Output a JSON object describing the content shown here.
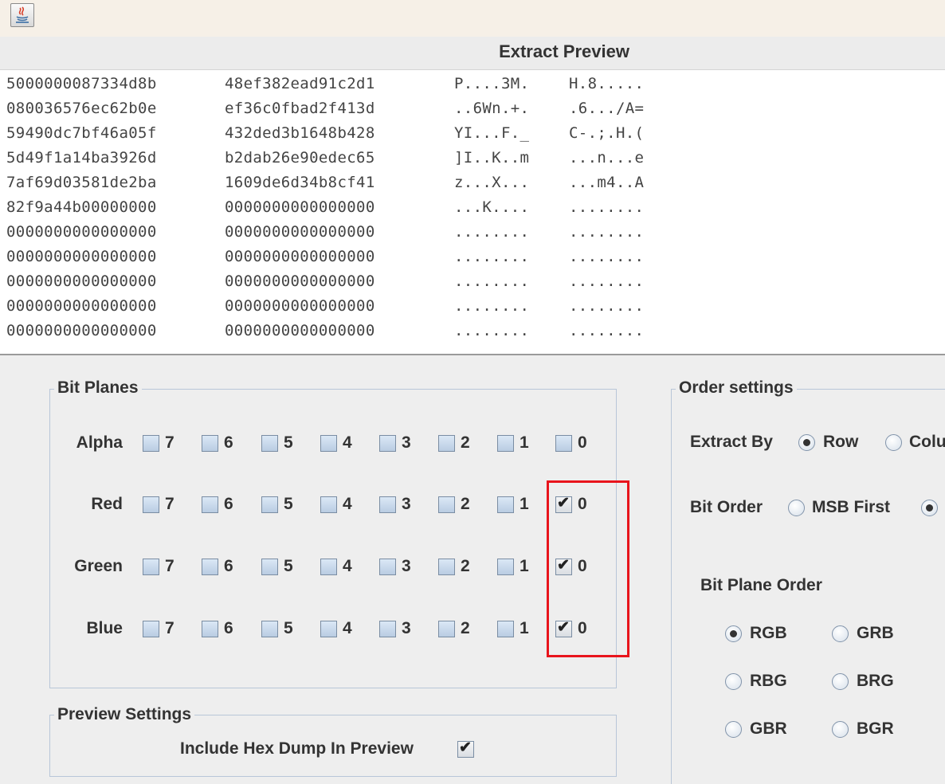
{
  "window": {
    "app_icon": "java-icon"
  },
  "preview": {
    "title": "Extract Preview",
    "lines": [
      {
        "hex1": "5000000087334d8b",
        "hex2": "48ef382ead91c2d1",
        "asc1": "P....3M.",
        "asc2": "H.8....."
      },
      {
        "hex1": "080036576ec62b0e",
        "hex2": "ef36c0fbad2f413d",
        "asc1": "..6Wn.+.",
        "asc2": ".6.../A="
      },
      {
        "hex1": "59490dc7bf46a05f",
        "hex2": "432ded3b1648b428",
        "asc1": "YI...F._",
        "asc2": "C-.;.H.("
      },
      {
        "hex1": "5d49f1a14ba3926d",
        "hex2": "b2dab26e90edec65",
        "asc1": "]I..K..m",
        "asc2": "...n...e"
      },
      {
        "hex1": "7af69d03581de2ba",
        "hex2": "1609de6d34b8cf41",
        "asc1": "z...X...",
        "asc2": "...m4..A"
      },
      {
        "hex1": "82f9a44b00000000",
        "hex2": "0000000000000000",
        "asc1": "...K....",
        "asc2": "........"
      },
      {
        "hex1": "0000000000000000",
        "hex2": "0000000000000000",
        "asc1": "........",
        "asc2": "........"
      },
      {
        "hex1": "0000000000000000",
        "hex2": "0000000000000000",
        "asc1": "........",
        "asc2": "........"
      },
      {
        "hex1": "0000000000000000",
        "hex2": "0000000000000000",
        "asc1": "........",
        "asc2": "........"
      },
      {
        "hex1": "0000000000000000",
        "hex2": "0000000000000000",
        "asc1": "........",
        "asc2": "........"
      },
      {
        "hex1": "0000000000000000",
        "hex2": "0000000000000000",
        "asc1": "........",
        "asc2": "........"
      }
    ]
  },
  "bit_planes": {
    "title": "Bit Planes",
    "bits": [
      "7",
      "6",
      "5",
      "4",
      "3",
      "2",
      "1",
      "0"
    ],
    "rows": [
      {
        "label": "Alpha",
        "checked": [
          false,
          false,
          false,
          false,
          false,
          false,
          false,
          false
        ]
      },
      {
        "label": "Red",
        "checked": [
          false,
          false,
          false,
          false,
          false,
          false,
          false,
          true
        ]
      },
      {
        "label": "Green",
        "checked": [
          false,
          false,
          false,
          false,
          false,
          false,
          false,
          true
        ]
      },
      {
        "label": "Blue",
        "checked": [
          false,
          false,
          false,
          false,
          false,
          false,
          false,
          true
        ]
      }
    ],
    "highlight_color": "#e8141c"
  },
  "preview_settings": {
    "title": "Preview Settings",
    "hex_dump_label": "Include Hex Dump In Preview",
    "hex_dump_checked": true
  },
  "order_settings": {
    "title": "Order settings",
    "extract_by_label": "Extract By",
    "extract_by_options": [
      {
        "label": "Row",
        "selected": true
      },
      {
        "label": "Colu",
        "selected": false
      }
    ],
    "bit_order_label": "Bit Order",
    "bit_order_options": [
      {
        "label": "MSB First",
        "selected": false
      },
      {
        "label": "",
        "selected": true
      }
    ],
    "bit_plane_order_label": "Bit Plane Order",
    "bit_plane_order_options": [
      {
        "label": "RGB",
        "selected": true
      },
      {
        "label": "GRB",
        "selected": false
      },
      {
        "label": "RBG",
        "selected": false
      },
      {
        "label": "BRG",
        "selected": false
      },
      {
        "label": "GBR",
        "selected": false
      },
      {
        "label": "BGR",
        "selected": false
      }
    ]
  },
  "colors": {
    "background": "#eeeeee",
    "titlebar": "#f6f0e7",
    "checkbox_fill": "#c9d9ec",
    "group_border": "#b8c6d8"
  }
}
